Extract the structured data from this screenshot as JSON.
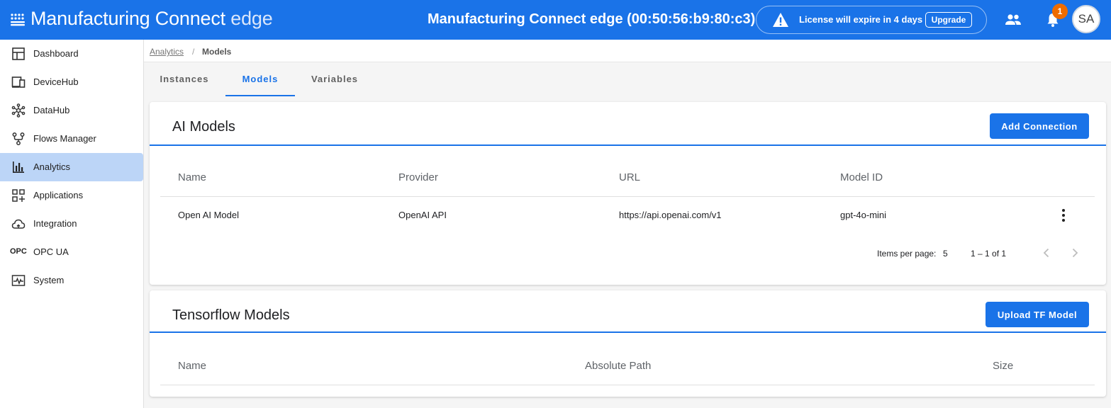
{
  "header": {
    "app_name_main": "Manufacturing Connect",
    "app_name_suffix": "edge",
    "device_title": "Manufacturing Connect edge (00:50:56:b9:80:c3)",
    "license_text": "License will expire in 4 days",
    "upgrade_label": "Upgrade",
    "notification_count": "1",
    "avatar_initials": "SA"
  },
  "sidebar": {
    "items": [
      {
        "label": "Dashboard",
        "icon": "dashboard-icon"
      },
      {
        "label": "DeviceHub",
        "icon": "devices-icon"
      },
      {
        "label": "DataHub",
        "icon": "hub-icon"
      },
      {
        "label": "Flows Manager",
        "icon": "flow-icon"
      },
      {
        "label": "Analytics",
        "icon": "bar-chart-icon",
        "active": true
      },
      {
        "label": "Applications",
        "icon": "apps-add-icon"
      },
      {
        "label": "Integration",
        "icon": "cloud-sync-icon"
      },
      {
        "label": "OPC UA",
        "icon_text": "OPC"
      },
      {
        "label": "System",
        "icon": "monitor-heart-icon"
      }
    ]
  },
  "breadcrumb": {
    "parent": "Analytics",
    "separator": "/",
    "current": "Models"
  },
  "tabs": [
    {
      "label": "Instances"
    },
    {
      "label": "Models",
      "active": true
    },
    {
      "label": "Variables"
    }
  ],
  "ai_models": {
    "title": "AI Models",
    "add_button": "Add Connection",
    "columns": [
      "Name",
      "Provider",
      "URL",
      "Model ID"
    ],
    "rows": [
      {
        "name": "Open AI Model",
        "provider": "OpenAI API",
        "url": "https://api.openai.com/v1",
        "model_id": "gpt-4o-mini"
      }
    ],
    "paginator": {
      "items_per_page_label": "Items per page:",
      "items_per_page": "5",
      "range": "1 – 1 of 1"
    }
  },
  "tf_models": {
    "title": "Tensorflow Models",
    "upload_button": "Upload TF Model",
    "columns": [
      "Name",
      "Absolute Path",
      "Size"
    ]
  },
  "colors": {
    "primary": "#1a73e8",
    "active_nav": "#bcd5f7",
    "badge": "#ef6c00"
  }
}
